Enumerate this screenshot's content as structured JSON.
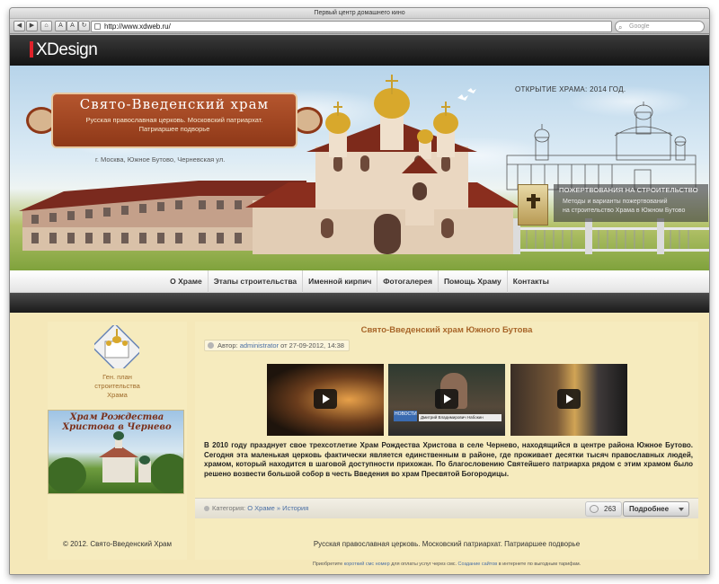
{
  "browser": {
    "window_title": "Первый центр домашнего кино",
    "url": "http://www.xdweb.ru/",
    "search_placeholder": "Google",
    "back_glyph": "◀",
    "forward_glyph": "▶",
    "home_glyph": "⌂",
    "font_small": "A",
    "font_large": "A",
    "reload_glyph": "↻"
  },
  "logo": {
    "text": "XDesign",
    "accent_color": "#e0222a"
  },
  "header": {
    "title": "Свято-Введенский храм",
    "subtitle_line1": "Русская православная церковь. Московский патриархат.",
    "subtitle_line2": "Патриаршее подворье",
    "address": "г. Москва, Южное Бутово, Черневская ул.",
    "opening": "ОТКРЫТИЕ ХРАМА: 2014 ГОД.",
    "donate_title": "ПОЖЕРТВОВАНИЯ НА СТРОИТЕЛЬСТВО",
    "donate_line1": "Методы и варианты пожертвований",
    "donate_line2": "на строительство Храма в Южном Бутово"
  },
  "nav": {
    "items": [
      "О Храме",
      "Этапы строительства",
      "Именной кирпич",
      "Фотогалерея",
      "Помощь Храму",
      "Контакты"
    ]
  },
  "sidebar": {
    "caption_line1": "Ген. план",
    "caption_line2": "строительства",
    "caption_line3": "Храма",
    "banner_line1": "Храм Рождества",
    "banner_line2": "Христова в Чернево",
    "copyright": "© 2012. Свято-Введенский Храм"
  },
  "post": {
    "title": "Свято-Введенский храм Южного Бутова",
    "author_prefix": "Автор:",
    "author_name": "administrator",
    "author_date": "от 27-09-2012, 14:38",
    "video2_caption": "Дмитрий Владимирович Набокин",
    "video2_news": "НОВОСТИ",
    "body": "В 2010 году празднует свое трехсотлетие Храм Рождества Христова в селе Чернево, находящийся в центре района Южное Бутово. Сегодня эта маленькая церковь фактически является единственным в районе, где проживает десятки тысяч православных людей, храмом, который находится в шаговой доступности прихожан. По благословению Святейшего патриарха рядом с этим храмом было решено возвести большой собор в честь Введения во храм Пресвятой Богородицы.",
    "category_prefix": "Категория:",
    "category_path": "О Храме » История",
    "views": "263",
    "more_label": "Подробнее"
  },
  "footer": {
    "main": "Русская православная церковь. Московский патриархат. Патриаршее подворье",
    "small_prefix": "Приобретите",
    "small_link1": "короткий смс номер",
    "small_mid": "для оплаты услуг через смс.",
    "small_link2": "Создание сайтов",
    "small_suffix": "в интернете по выгодным тарифам."
  }
}
